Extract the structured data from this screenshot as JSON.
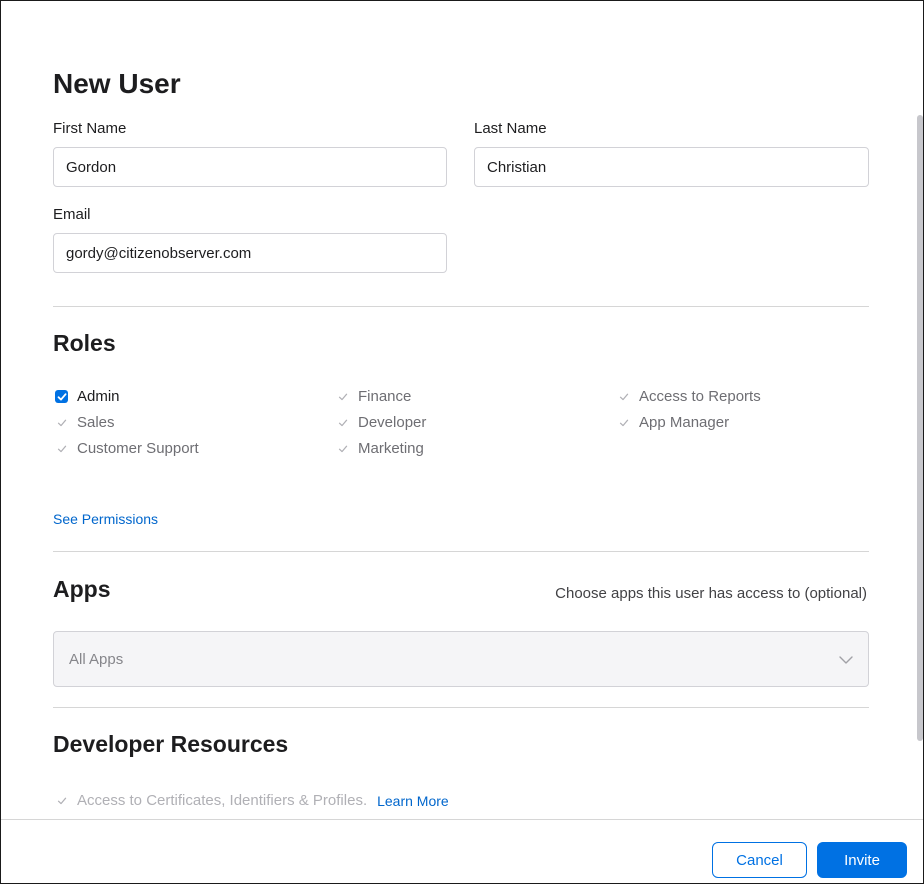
{
  "form": {
    "title": "New User",
    "first_name_label": "First Name",
    "first_name_value": "Gordon",
    "last_name_label": "Last Name",
    "last_name_value": "Christian",
    "email_label": "Email",
    "email_value": "gordy@citizenobserver.com"
  },
  "roles": {
    "heading": "Roles",
    "items": [
      {
        "label": "Admin",
        "checked": true,
        "enabled": true
      },
      {
        "label": "Sales",
        "checked": true,
        "enabled": false
      },
      {
        "label": "Customer Support",
        "checked": true,
        "enabled": false
      },
      {
        "label": "Finance",
        "checked": true,
        "enabled": false
      },
      {
        "label": "Developer",
        "checked": true,
        "enabled": false
      },
      {
        "label": "Marketing",
        "checked": true,
        "enabled": false
      },
      {
        "label": "Access to Reports",
        "checked": true,
        "enabled": false
      },
      {
        "label": "App Manager",
        "checked": true,
        "enabled": false
      }
    ],
    "see_permissions_label": "See Permissions"
  },
  "apps": {
    "heading": "Apps",
    "hint": "Choose apps this user has access to (optional)",
    "selected_value": "All Apps"
  },
  "developer_resources": {
    "heading": "Developer Resources",
    "checkbox_label": "Access to Certificates, Identifiers & Profiles.",
    "learn_more_label": "Learn More"
  },
  "footer": {
    "cancel_label": "Cancel",
    "invite_label": "Invite"
  },
  "colors": {
    "accent": "#0071e3",
    "link": "#0066cc",
    "disabled_text": "#6e6e73",
    "border": "#d2d2d7"
  },
  "icons": {
    "checkbox_checked": "checkmark-icon",
    "select_chevron": "chevron-down-icon"
  }
}
